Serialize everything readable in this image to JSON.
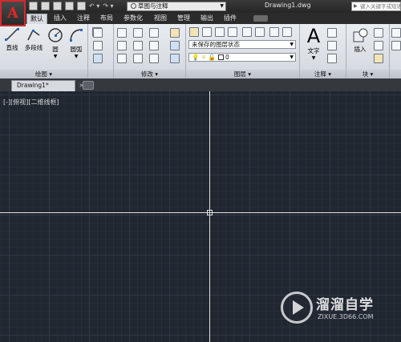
{
  "title_bar": {
    "workspace": "草图与注释",
    "document_title": "Drawing1.dwg",
    "search_placeholder": "键入关键字或短语"
  },
  "tabs": [
    "默认",
    "插入",
    "注释",
    "布局",
    "参数化",
    "视图",
    "管理",
    "输出",
    "插件"
  ],
  "ribbon": {
    "draw": {
      "footer": "绘图",
      "tools": [
        "直线",
        "多段线",
        "圆",
        "圆弧"
      ]
    },
    "modify": {
      "footer": "修改"
    },
    "layers": {
      "footer": "图层",
      "layer_state": "未保存的图层状态",
      "current_layer": "0"
    },
    "annotation": {
      "footer": "注释",
      "text_tool": "文字"
    },
    "block": {
      "footer": "块",
      "insert_tool": "插入"
    }
  },
  "file_tab": {
    "label": "Drawing1*"
  },
  "viewport": {
    "label": "[-][俯视][二维线框]"
  },
  "watermark": {
    "name": "溜溜自学",
    "url": "ZIXUE.3D66.COM"
  },
  "colors": {
    "app_button_border": "#d8282b",
    "canvas_bg": "#212731",
    "crosshair": "#e0e0e0"
  }
}
